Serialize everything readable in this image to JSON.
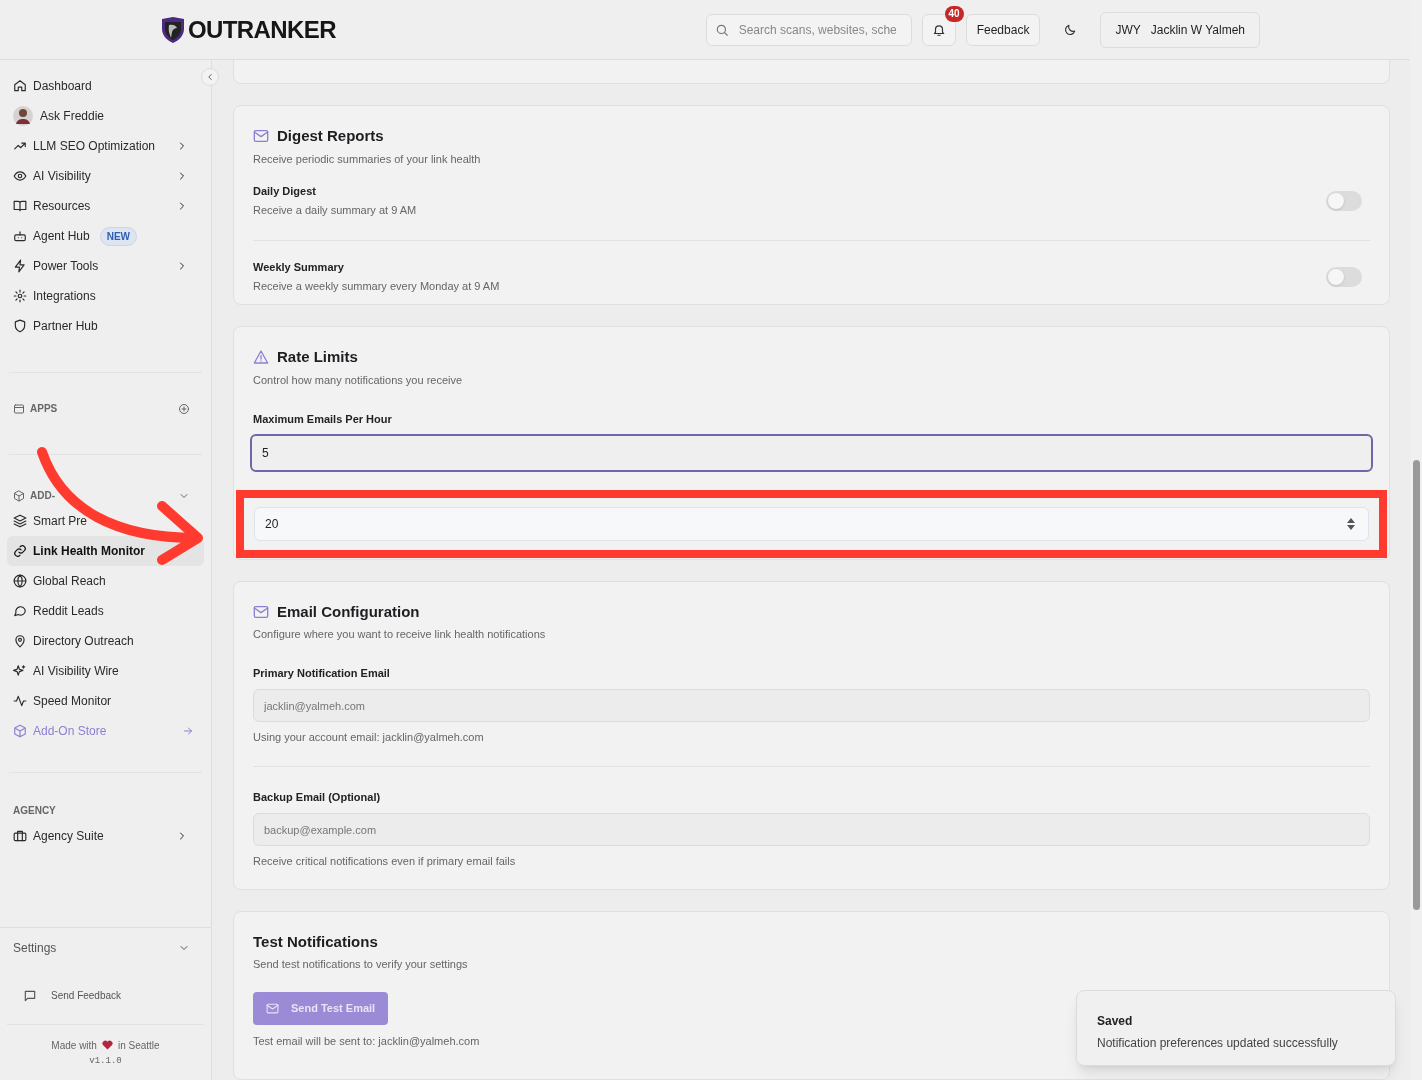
{
  "header": {
    "logo": "OUTRANKER",
    "search": {
      "placeholder": "Search scans, websites, sche"
    },
    "notifications": "40",
    "feedback": "Feedback",
    "user_initials": "JWY",
    "user_name": "Jacklin W Yalmeh"
  },
  "sidebar": {
    "items": [
      {
        "label": "Dashboard",
        "chevron": false
      },
      {
        "label": "Ask Freddie",
        "chevron": false
      },
      {
        "label": "LLM SEO Optimization",
        "chevron": true
      },
      {
        "label": "AI Visibility",
        "chevron": true
      },
      {
        "label": "Resources",
        "chevron": true
      },
      {
        "label": "Agent Hub",
        "chevron": false,
        "badge": "NEW"
      },
      {
        "label": "Power Tools",
        "chevron": true
      },
      {
        "label": "Integrations",
        "chevron": false
      },
      {
        "label": "Partner Hub",
        "chevron": false
      }
    ],
    "apps_heading": "APPS",
    "addons_heading": "ADD-",
    "addons": [
      {
        "label": "Smart Pre",
        "selected": false
      },
      {
        "label": "Link Health Monitor",
        "selected": true
      },
      {
        "label": "Global Reach",
        "selected": false
      },
      {
        "label": "Reddit Leads",
        "selected": false
      },
      {
        "label": "Directory Outreach",
        "selected": false
      },
      {
        "label": "AI Visibility Wire",
        "selected": false
      },
      {
        "label": "Speed Monitor",
        "selected": false
      }
    ],
    "store": "Add-On Store",
    "agency_heading": "AGENCY",
    "agency": "Agency Suite",
    "settings": "Settings",
    "send_feedback": "Send Feedback",
    "made_with": "Made with",
    "in_city": "in Seattle",
    "version": "v1.1.0"
  },
  "sections": [
    {
      "kind": "toggles",
      "title": "Digest Reports",
      "subtitle": "Receive periodic summaries of your link health",
      "rows": [
        {
          "label": "Daily Digest",
          "description": "Receive a daily summary at 9 AM",
          "on": false
        },
        {
          "label": "Weekly Summary",
          "description": "Receive a weekly summary every Monday at 9 AM",
          "on": false
        }
      ]
    },
    {
      "kind": "numbers",
      "title": "Rate Limits",
      "subtitle": "Control how many notifications you receive",
      "fields": [
        {
          "label": "Maximum Emails Per Hour",
          "value": "5",
          "focused": true,
          "highlighted": false
        },
        {
          "value": "20",
          "focused": false,
          "highlighted": true
        }
      ]
    },
    {
      "kind": "emails",
      "title": "Email Configuration",
      "subtitle": "Configure where you want to receive link health notifications",
      "fields": [
        {
          "label": "Primary Notification Email",
          "placeholder": "jacklin@yalmeh.com",
          "help": "Using your account email: jacklin@yalmeh.com"
        },
        {
          "label": "Backup Email (Optional)",
          "placeholder": "backup@example.com",
          "help": "Receive critical notifications even if primary email fails"
        }
      ]
    },
    {
      "kind": "test",
      "title": "Test Notifications",
      "subtitle": "Send test notifications to verify your settings",
      "button": "Send Test Email",
      "note": "Test email will be sent to: jacklin@yalmeh.com"
    }
  ],
  "toast": {
    "title": "Saved",
    "message": "Notification preferences updated successfully"
  }
}
